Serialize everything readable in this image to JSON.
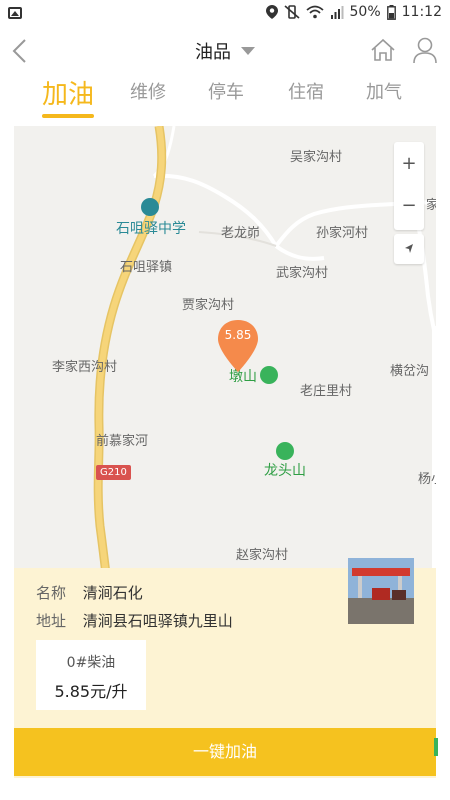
{
  "status_bar": {
    "battery": "50%",
    "time": "11:12"
  },
  "nav": {
    "title": "油品"
  },
  "tabs": [
    {
      "label": "加油"
    },
    {
      "label": "维修"
    },
    {
      "label": "停车"
    },
    {
      "label": "住宿"
    },
    {
      "label": "加气"
    }
  ],
  "map": {
    "labels": {
      "wujiagou": "吴家沟村",
      "school": "石咀驿中学",
      "laolongbi": "老龙峁",
      "sunjiahe": "孙家河村",
      "shijuyi": "石咀驿镇",
      "wujiagou2": "武家沟村",
      "jiajiagou": "贾家沟村",
      "lijiaxigou": "李家西沟村",
      "dunshan": "墩山",
      "laozhuangli": "老庄里村",
      "hengchagou": "横岔沟",
      "qianmujiahe": "前慕家河",
      "longtoushan": "龙头山",
      "yang": "杨小",
      "zhaojiagou": "赵家沟村",
      "edge_right": "家台"
    },
    "road_sign": "G210",
    "zoom_in": "+",
    "zoom_out": "−",
    "marker_price": "5.85",
    "colors": {
      "background": "#f2f1ee",
      "road_main": "#f6d57a",
      "road_minor": "#ffffff",
      "marker": "#f58a4b"
    }
  },
  "station": {
    "name_key": "名称",
    "name_value": "清涧石化",
    "address_key": "地址",
    "address_value": "清涧县石咀驿镇九里山",
    "fuel_type": "0#柴油",
    "price": "5.85元/升"
  },
  "action": {
    "refuel_label": "一键加油"
  },
  "colors": {
    "accent": "#f5b81c",
    "sheet_bg": "#fdf3d3",
    "button": "#f5c21f"
  }
}
